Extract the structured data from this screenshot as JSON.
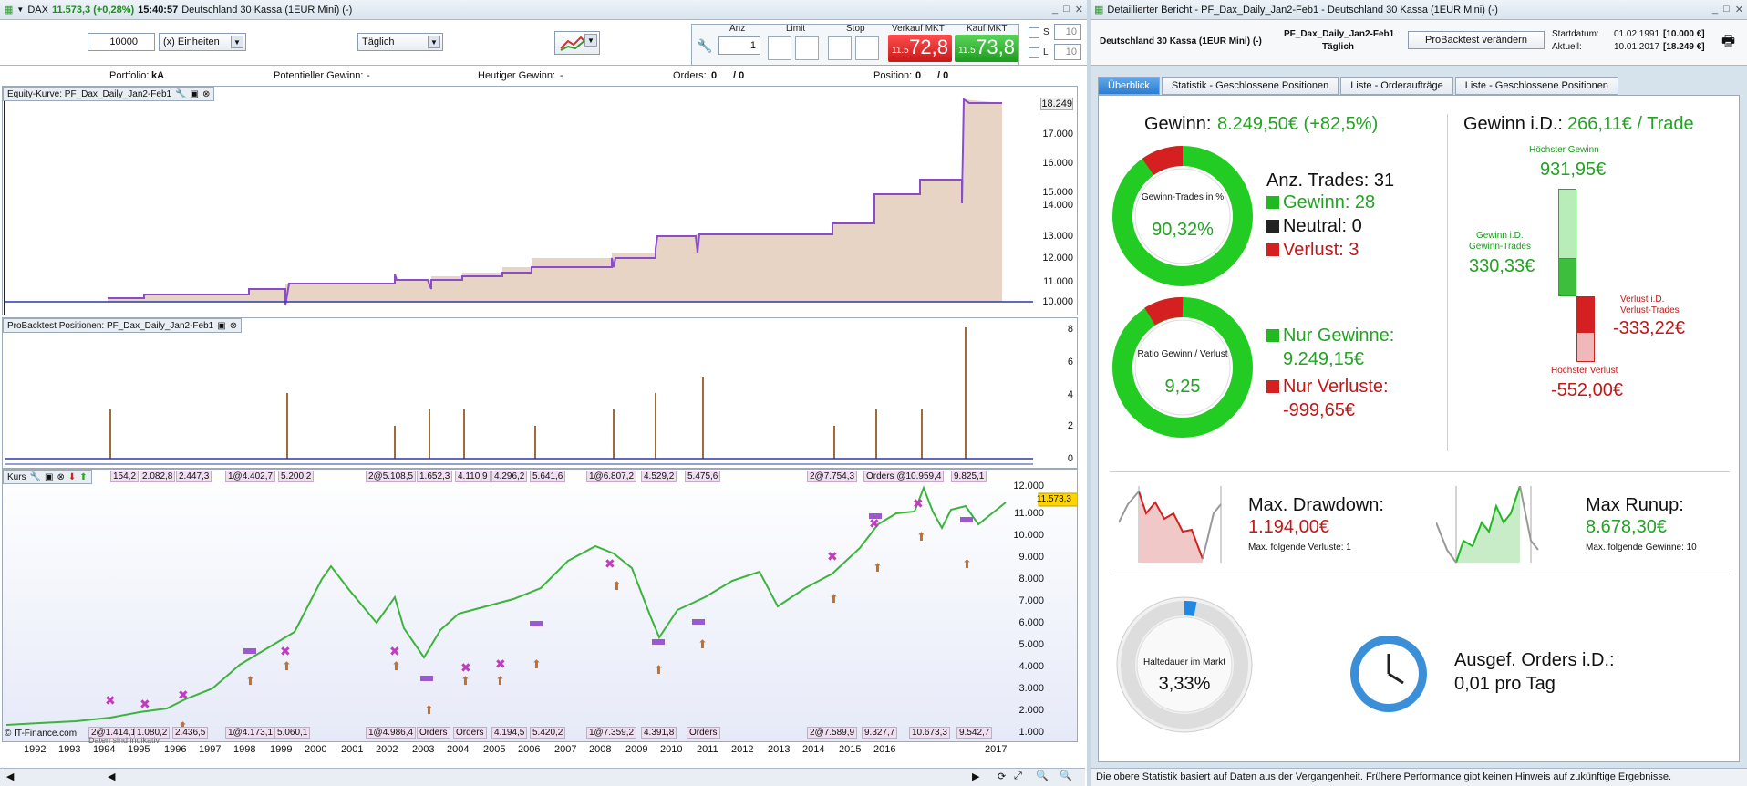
{
  "left": {
    "title": {
      "symbol": "DAX",
      "price": "11.573,3 (+0,28%)",
      "time": "15:40:57",
      "name": "Deutschland 30 Kassa (1EUR Mini) (-)"
    },
    "toolbar": {
      "qty": "10000",
      "units": "(x) Einheiten",
      "period": "Täglich",
      "anz_label": "Anz",
      "anz_value": "1",
      "limit_label": "Limit",
      "stop_label": "Stop",
      "sell_label": "Verkauf MKT",
      "buy_label": "Kauf MKT",
      "sell_small": "11.5",
      "sell_big": "72,8",
      "buy_small": "11.5",
      "buy_big": "73,8",
      "s_label": "S",
      "l_label": "L",
      "s_value": "10",
      "l_value": "10"
    },
    "infobar": {
      "portfolio_label": "Portfolio:",
      "portfolio_value": "kA",
      "pot_label": "Potentieller Gewinn:",
      "pot_value": "-",
      "today_label": "Heutiger Gewinn:",
      "today_value": "-",
      "orders_label": "Orders:",
      "orders_value": "0",
      "orders_value2": "/ 0",
      "pos_label": "Position:",
      "pos_value": "0",
      "pos_value2": "/ 0"
    },
    "equity": {
      "title": "Equity-Kurve: PF_Dax_Daily_Jan2-Feb1",
      "last": "18.249",
      "ticks": [
        "17.000",
        "16.000",
        "15.000",
        "14.000",
        "13.000",
        "12.000",
        "11.000",
        "10.000"
      ]
    },
    "positions": {
      "title": "ProBacktest Positionen: PF_Dax_Daily_Jan2-Feb1",
      "ticks": [
        "8",
        "6",
        "4",
        "2",
        "0"
      ]
    },
    "price": {
      "title": "Kurs",
      "last": "11.573,3",
      "ticks": [
        "12.000",
        "11.000",
        "10.000",
        "9.000",
        "8.000",
        "7.000",
        "6.000",
        "5.000",
        "4.000",
        "3.000",
        "2.000",
        "1.000"
      ],
      "top_tags": [
        "154,2",
        "2.082,8",
        "2.447,3",
        "1@4.402,7",
        "5.200,2",
        "2@5.108,5",
        "1.652,3",
        "4.110,9",
        "4.296,2",
        "5.641,6",
        "1@6.807,2",
        "4.529,2",
        "5.475,6",
        "2@7.754,3",
        "Orders @10.959,4",
        "9.825,1"
      ],
      "bottom_tags": [
        "2@1.414,1",
        "1.080,2",
        "2.436,5",
        "1@4.173,1",
        "5.060,1",
        "1@4.986,4",
        "Orders",
        "Orders",
        "4.194,5",
        "5.420,2",
        "1@7.359,2",
        "4.391,8",
        "Orders",
        "2@7.589,9",
        "9.327,7",
        "10.673,3",
        "9.542,7"
      ],
      "copyright": "© IT-Finance.com",
      "source": "Daten sind indikativ",
      "years": [
        "1992",
        "1993",
        "1994",
        "1995",
        "1996",
        "1997",
        "1998",
        "1999",
        "2000",
        "2001",
        "2002",
        "2003",
        "2004",
        "2005",
        "2006",
        "2007",
        "2008",
        "2009",
        "2010",
        "2011",
        "2012",
        "2013",
        "2014",
        "2015",
        "2016",
        "2017"
      ]
    }
  },
  "right": {
    "title": "Detaillierter Bericht - PF_Dax_Daily_Jan2-Feb1 - Deutschland 30 Kassa (1EUR Mini) (-)",
    "instrument": "Deutschland 30 Kassa (1EUR Mini) (-)",
    "strategy": "PF_Dax_Daily_Jan2-Feb1",
    "period": "Täglich",
    "change_btn": "ProBacktest verändern",
    "start_label": "Startdatum:",
    "start_date": "01.02.1991",
    "start_value": "[10.000 €]",
    "current_label": "Aktuell:",
    "current_date": "10.01.2017",
    "current_value": "[18.249 €]",
    "tabs": [
      "Überblick",
      "Statistik - Geschlossene Positionen",
      "Liste - Orderaufträge",
      "Liste - Geschlossene Positionen"
    ],
    "profit_label": "Gewinn:",
    "profit_value": "8.249,50€ (+82,5%)",
    "avg_label": "Gewinn i.D.:",
    "avg_value": "266,11€ / Trade",
    "donut1_label": "Gewinn-Trades in %",
    "donut1_value": "90,32%",
    "donut1_pct": 90.32,
    "trades_label": "Anz. Trades: 31",
    "win_label": "Gewinn: 28",
    "neutral_label": "Neutral: 0",
    "loss_label": "Verlust: 3",
    "donut2_label": "Ratio Gewinn / Verlust",
    "donut2_value": "9,25",
    "only_win_label": "Nur Gewinne:",
    "only_win_value": "9.249,15€",
    "only_loss_label": "Nur Verluste:",
    "only_loss_value": "-999,65€",
    "max_gain_label": "Höchster Gewinn",
    "max_gain_value": "931,95€",
    "avg_win_label1": "Gewinn i.D.",
    "avg_win_label2": "Gewinn-Trades",
    "avg_win_value": "330,33€",
    "avg_loss_label1": "Verlust i.D.",
    "avg_loss_label2": "Verlust-Trades",
    "avg_loss_value": "-333,22€",
    "max_loss_label": "Höchster Verlust",
    "max_loss_value": "-552,00€",
    "dd_label": "Max. Drawdown:",
    "dd_value": "1.194,00€",
    "dd_sub": "Max. folgende Verluste: 1",
    "ru_label": "Max Runup:",
    "ru_value": "8.678,30€",
    "ru_sub": "Max. folgende Gewinne: 10",
    "hold_label": "Haltedauer im Markt",
    "hold_value": "3,33%",
    "hold_pct": 3.33,
    "orders_label": "Ausgef. Orders i.D.:",
    "orders_value": "0,01 pro Tag",
    "footer": "Die obere Statistik basiert auf Daten aus der Vergangenheit. Frühere Performance gibt keinen Hinweis auf zukünftige Ergebnisse.",
    "colors": {
      "green": "#22a322",
      "red": "#c01818",
      "donut_green": "#22cc22",
      "donut_red": "#d42020"
    }
  }
}
